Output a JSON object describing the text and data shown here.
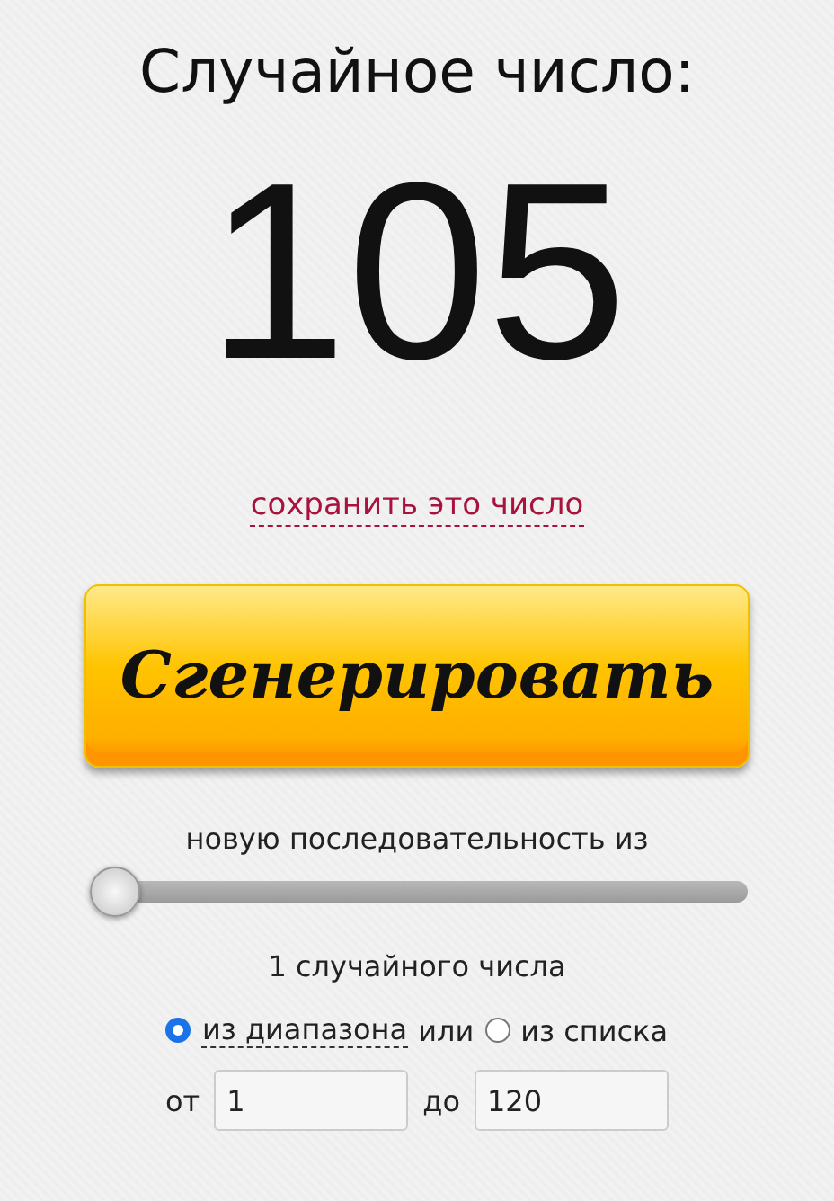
{
  "title": "Случайное число:",
  "result": "105",
  "save_link": "сохранить это число",
  "generate_button": "Сгенерировать",
  "sequence_label": "новую последовательность из",
  "count_slider": {
    "level": 0
  },
  "count_label": "1 случайного числа",
  "sources": [
    {
      "label": "из диапазона",
      "selected": true
    },
    {
      "label": "из списка",
      "selected": false
    }
  ],
  "sources_joiner": "или",
  "range": {
    "from_label": "от",
    "from_value": "1",
    "to_label": "до",
    "to_value": "120"
  }
}
